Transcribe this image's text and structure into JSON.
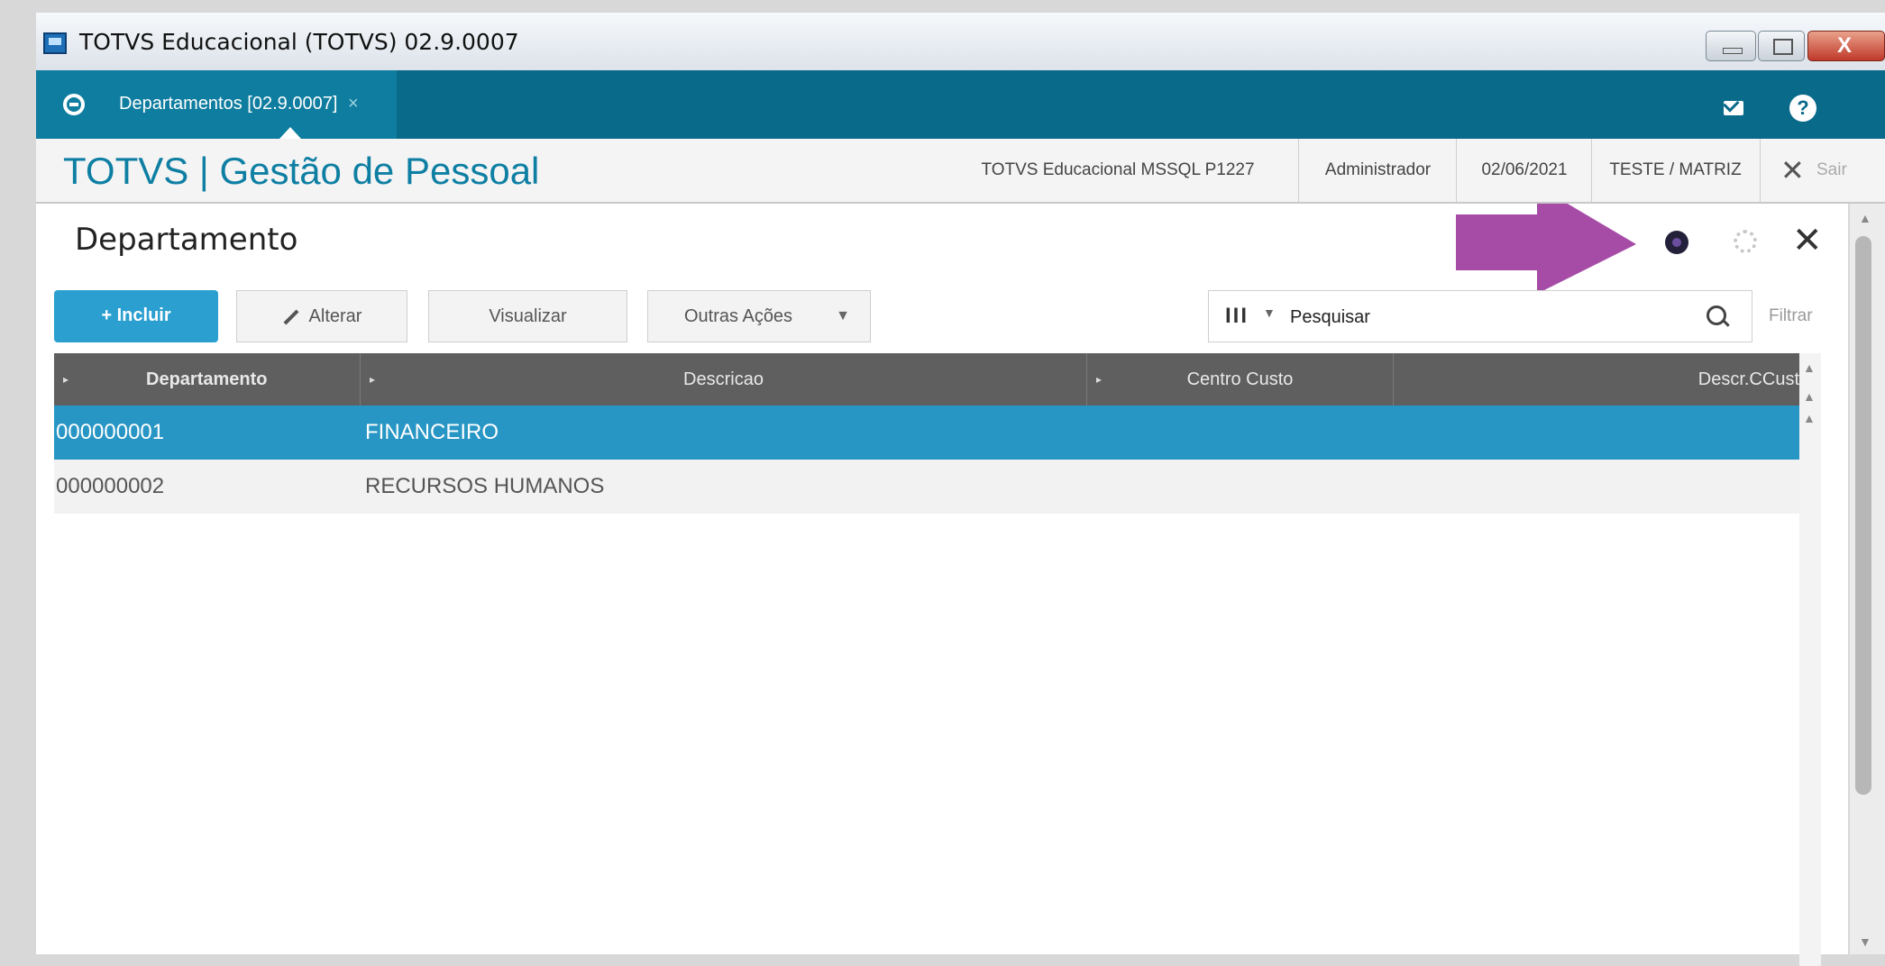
{
  "window": {
    "title": "TOTVS Educacional (TOTVS) 02.9.0007",
    "close_glyph": "X"
  },
  "topbar": {
    "tab_label": "Departamentos [02.9.0007]",
    "tab_close": "×",
    "help_glyph": "?"
  },
  "module": {
    "title": "TOTVS | Gestão de Pessoal",
    "database": "TOTVS Educacional MSSQL P1227",
    "user": "Administrador",
    "date": "02/06/2021",
    "branch": "TESTE / MATRIZ",
    "logout_glyph": "✕",
    "logout_label": "Sair"
  },
  "page": {
    "title": "Departamento",
    "close_glyph": "✕"
  },
  "toolbar": {
    "incluir": "+ Incluir",
    "alterar": "Alterar",
    "visualizar": "Visualizar",
    "outras_acoes": "Outras Ações",
    "dropdown_glyph": "▼",
    "columns_glyph": "III",
    "columns_caret": "▼",
    "search_placeholder": "Pesquisar",
    "filtrar": "Filtrar"
  },
  "grid": {
    "header_marker": "▸",
    "columns": [
      "Departamento",
      "Descricao",
      "Centro Custo",
      "Descr.CCust"
    ],
    "rows": [
      {
        "departamento": "000000001",
        "descricao": "FINANCEIRO",
        "selected": true
      },
      {
        "departamento": "000000002",
        "descricao": "RECURSOS HUMANOS",
        "selected": false
      }
    ]
  },
  "scroll": {
    "up": "▲",
    "down": "▼"
  },
  "colors": {
    "header_teal": "#0a6a8a",
    "module_title": "#0e7fa3",
    "primary_button": "#2a9fd0",
    "selected_row": "#2896c4",
    "annotation_arrow": "#a64ca6"
  },
  "icons": {
    "annotation": "purple-arrow-icon",
    "menu": "circle-menu-icon",
    "mail": "mail-icon",
    "help": "help-icon",
    "search": "search-icon",
    "settings": "gear-icon"
  }
}
